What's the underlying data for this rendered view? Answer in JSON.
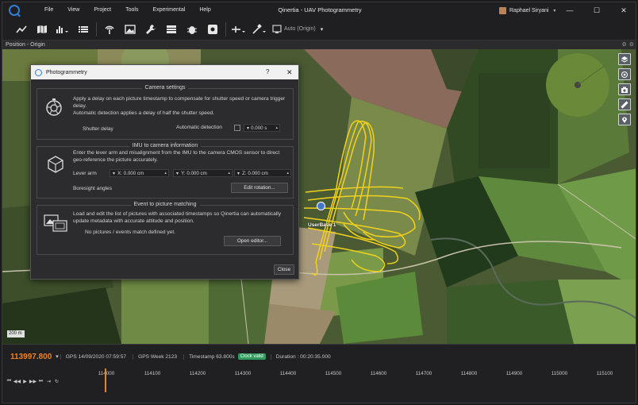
{
  "app": {
    "window_title": "Qinertia - UAV Photogrammetry",
    "menu": [
      "File",
      "View",
      "Project",
      "Tools",
      "Experimental",
      "Help"
    ],
    "user": "Raphael Siryani",
    "win_controls": {
      "minimize": "—",
      "maximize": "☐",
      "close": "✕"
    }
  },
  "toolbar": {
    "mode_label": "Auto (Origin)",
    "icons": [
      "chart-line-icon",
      "map-icon",
      "bar-chart-icon",
      "list-icon",
      "antenna-icon",
      "image-icon",
      "wrench-icon",
      "database-icon",
      "bug-icon",
      "settings-box-icon",
      "trajectory-icon",
      "satellite-icon",
      "screen-icon"
    ]
  },
  "panel": {
    "title": "Position - Origin"
  },
  "map": {
    "marker_label": "UserBase 1",
    "scale_label": "200 m",
    "tools": [
      "layers-icon",
      "target-icon",
      "camera-icon",
      "ruler-icon",
      "pin-icon"
    ]
  },
  "dialog": {
    "title": "Photogrammetry",
    "help": "?",
    "close_x": "✕",
    "camera": {
      "title": "Camera settings",
      "text": "Apply a delay on each picture timestamp to compensate for shutter speed or camera trigger delay.",
      "text2": "Automatic detection applies a delay of half the shutter speed.",
      "shutter_label": "Shutter delay",
      "auto_label": "Automatic detection",
      "shutter_value": "0.000 s"
    },
    "imu": {
      "title": "IMU to camera information",
      "text": "Enter the lever arm and misalignment from the IMU to the camera CMOS sensor to direct geo-reference the picture accurately.",
      "lever_label": "Lever arm",
      "x": "X: 0.000 cm",
      "y": "Y: 0.000 cm",
      "z": "Z: 0.000 cm",
      "boresight_label": "Boresight angles",
      "edit_rotation": "Edit rotation..."
    },
    "event": {
      "title": "Event to picture matching",
      "text": "Load and edit the list of pictures with associated timestamps so Qinertia can automatically update metadata with accurate attitude and position.",
      "status": "No pictures / events match defined yet.",
      "open_editor": "Open editor..."
    },
    "close_button": "Close"
  },
  "timeline": {
    "current_time": "113997.800",
    "gps_date": "GPS 14/09/2020 07:59:57",
    "gps_week": "GPS Week 2123",
    "timestamp": "Timestamp 63.800s",
    "clock_status": "Clock valid",
    "duration": "Duration : 00:20:35.000",
    "ticks": [
      "114000",
      "114100",
      "114200",
      "114300",
      "114400",
      "114500",
      "114600",
      "114700",
      "114800",
      "114900",
      "115000",
      "115100"
    ],
    "controls": [
      "first-icon",
      "rewind-icon",
      "play-icon",
      "fast-forward-icon",
      "last-icon",
      "jump-icon",
      "loop-icon"
    ]
  },
  "colors": {
    "accent": "#f08020",
    "trajectory": "#f2d21b",
    "clock_valid": "#2f9b5e"
  }
}
